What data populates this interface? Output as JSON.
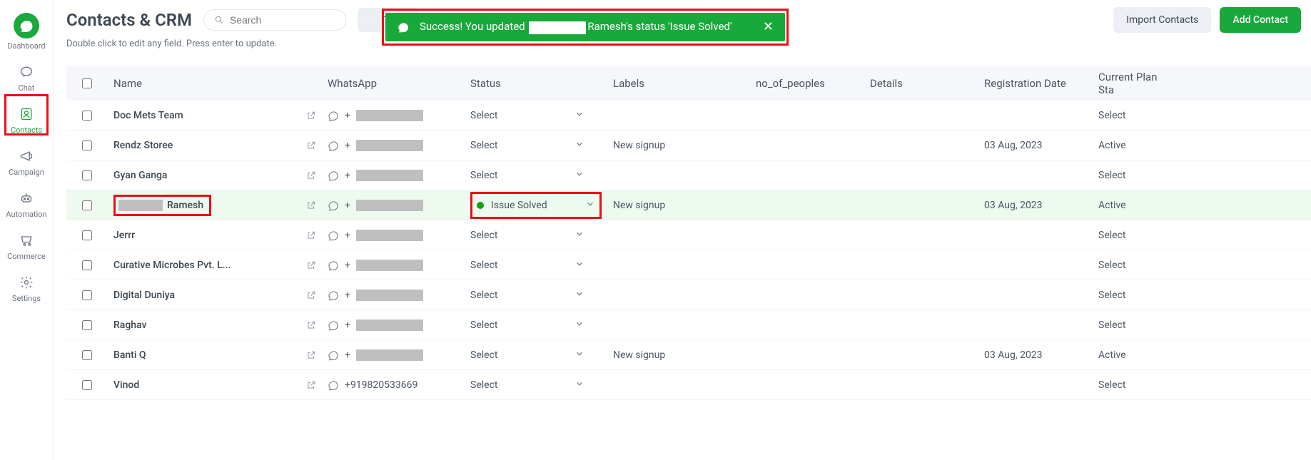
{
  "sidebar": {
    "items": [
      {
        "label": "Dashboard",
        "icon": "logo"
      },
      {
        "label": "Chat"
      },
      {
        "label": "Contacts"
      },
      {
        "label": "Campaign"
      },
      {
        "label": "Automation"
      },
      {
        "label": "Commerce"
      },
      {
        "label": "Settings"
      }
    ],
    "active_index": 2
  },
  "header": {
    "title": "Contacts & CRM",
    "search_placeholder": "Search",
    "subtitle": "Double click to edit any field. Press enter to update.",
    "import_label": "Import Contacts",
    "add_label": "Add Contact"
  },
  "toast": {
    "prefix": "Success! You updated ",
    "suffix": "Ramesh's status 'Issue Solved'"
  },
  "table": {
    "columns": [
      "",
      "Name",
      "WhatsApp",
      "Status",
      "Labels",
      "no_of_peoples",
      "Details",
      "Registration Date",
      "Current Plan Sta"
    ],
    "select_label": "Select",
    "rows": [
      {
        "name": "Doc Mets Team",
        "wa_redacted": true,
        "status": "Select",
        "labels": "",
        "reg": "",
        "plan": "Select"
      },
      {
        "name": "Rendz Storee",
        "wa_redacted": true,
        "status": "Select",
        "labels": "New signup",
        "reg": "03 Aug, 2023",
        "plan": "Active"
      },
      {
        "name": "Gyan Ganga",
        "wa_redacted": true,
        "status": "Select",
        "labels": "",
        "reg": "",
        "plan": "Select"
      },
      {
        "name_redacted": true,
        "name_suffix": "Ramesh",
        "wa_redacted": true,
        "status": "Issue Solved",
        "status_dot": true,
        "labels": "New signup",
        "reg": "03 Aug, 2023",
        "plan": "Active",
        "highlight": true
      },
      {
        "name": "Jerrr",
        "wa_redacted": true,
        "status": "Select",
        "labels": "",
        "reg": "",
        "plan": "Select"
      },
      {
        "name": "Curative Microbes Pvt. L...",
        "wa_redacted": true,
        "status": "Select",
        "labels": "",
        "reg": "",
        "plan": "Select"
      },
      {
        "name": "Digital Duniya",
        "wa_redacted": true,
        "status": "Select",
        "labels": "",
        "reg": "",
        "plan": "Select"
      },
      {
        "name": "Raghav",
        "wa_redacted": true,
        "status": "Select",
        "labels": "",
        "reg": "",
        "plan": "Select"
      },
      {
        "name": "Banti Q",
        "wa_redacted": true,
        "status": "Select",
        "labels": "New signup",
        "reg": "03 Aug, 2023",
        "plan": "Active"
      },
      {
        "name": "Vinod",
        "wa": "+919820533669",
        "status": "Select",
        "labels": "",
        "reg": "",
        "plan": "Select"
      }
    ]
  }
}
